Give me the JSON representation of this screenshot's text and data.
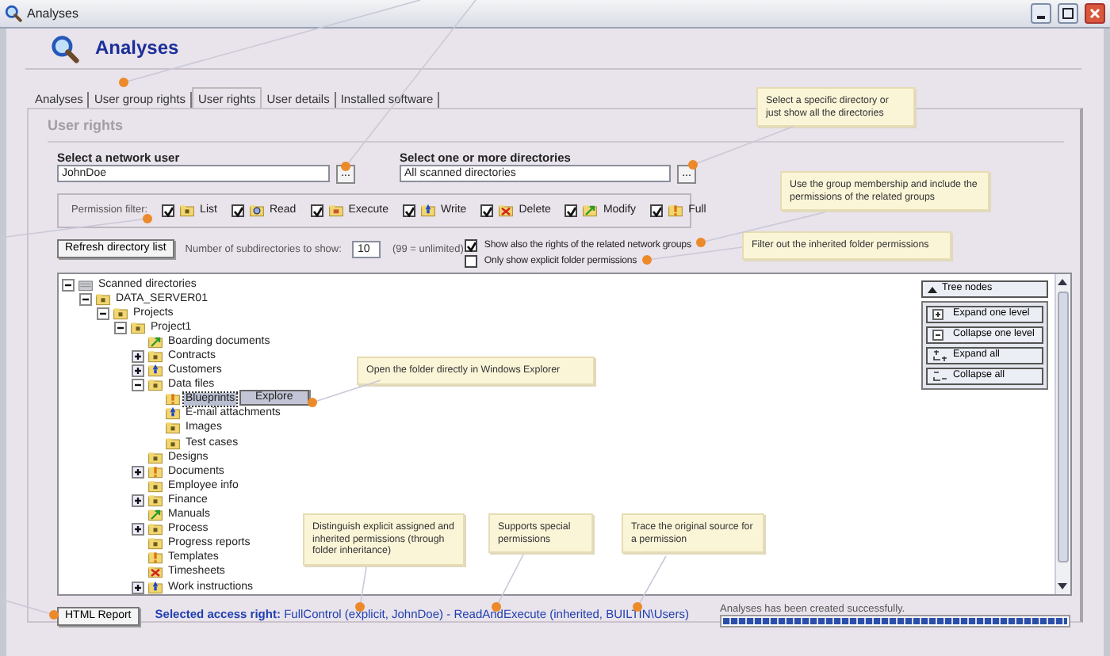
{
  "window": {
    "title": "Analyses"
  },
  "header": {
    "title": "Analyses"
  },
  "tabs": [
    {
      "label": "Analyses",
      "selected": false
    },
    {
      "label": "User group rights",
      "selected": false
    },
    {
      "label": "User rights",
      "selected": true
    },
    {
      "label": "User details",
      "selected": false
    },
    {
      "label": "Installed software",
      "selected": false
    }
  ],
  "section_title": "User rights",
  "user_select": {
    "label": "Select a network user",
    "value": "JohnDoe",
    "button": "..."
  },
  "directory_select": {
    "label": "Select one or more directories",
    "value": "All scanned directories",
    "button": "..."
  },
  "permission_filter": {
    "label": "Permission filter:",
    "items": [
      {
        "label": "List",
        "kind": "list",
        "checked": true
      },
      {
        "label": "Read",
        "kind": "read",
        "checked": true
      },
      {
        "label": "Execute",
        "kind": "execute",
        "checked": true
      },
      {
        "label": "Write",
        "kind": "write",
        "checked": true
      },
      {
        "label": "Delete",
        "kind": "delete",
        "checked": true
      },
      {
        "label": "Modify",
        "kind": "modify",
        "checked": true
      },
      {
        "label": "Full",
        "kind": "full",
        "checked": true
      }
    ]
  },
  "refresh_button": "Refresh directory list",
  "subdirectories": {
    "label": "Number of subdirectories to show:",
    "value": "10",
    "hint": "(99 = unlimited)"
  },
  "options": [
    {
      "label": "Show also the rights of the related network groups",
      "checked": true
    },
    {
      "label": "Only show explicit folder permissions",
      "checked": false
    }
  ],
  "tree": [
    {
      "label": "Scanned directories",
      "kind": "root",
      "expandable": true,
      "expanded": true,
      "selected": false,
      "children": [
        {
          "label": "DATA_SERVER01",
          "kind": "list",
          "expandable": true,
          "expanded": true,
          "selected": false,
          "children": [
            {
              "label": "Projects",
              "kind": "list",
              "expandable": true,
              "expanded": true,
              "selected": false,
              "children": [
                {
                  "label": "Project1",
                  "kind": "list",
                  "expandable": true,
                  "expanded": true,
                  "selected": false,
                  "children": [
                    {
                      "label": "Boarding documents",
                      "kind": "modify",
                      "expandable": false,
                      "selected": false
                    },
                    {
                      "label": "Contracts",
                      "kind": "list",
                      "expandable": true,
                      "expanded": false,
                      "selected": false
                    },
                    {
                      "label": "Customers",
                      "kind": "write",
                      "expandable": true,
                      "expanded": false,
                      "selected": false
                    },
                    {
                      "label": "Data files",
                      "kind": "list",
                      "expandable": true,
                      "expanded": true,
                      "selected": false,
                      "children": [
                        {
                          "label": "Blueprints",
                          "kind": "full",
                          "expandable": false,
                          "selected": true
                        },
                        {
                          "label": "E-mail attachments",
                          "kind": "write",
                          "expandable": false,
                          "selected": false
                        },
                        {
                          "label": "Images",
                          "kind": "list",
                          "expandable": false,
                          "selected": false
                        },
                        {
                          "label": "Test cases",
                          "kind": "list",
                          "expandable": false,
                          "selected": false
                        }
                      ]
                    },
                    {
                      "label": "Designs",
                      "kind": "list",
                      "expandable": false,
                      "selected": false
                    },
                    {
                      "label": "Documents",
                      "kind": "full",
                      "expandable": true,
                      "expanded": false,
                      "selected": false
                    },
                    {
                      "label": "Employee info",
                      "kind": "list",
                      "expandable": false,
                      "selected": false
                    },
                    {
                      "label": "Finance",
                      "kind": "list",
                      "expandable": true,
                      "expanded": false,
                      "selected": false
                    },
                    {
                      "label": "Manuals",
                      "kind": "modify",
                      "expandable": false,
                      "selected": false
                    },
                    {
                      "label": "Process",
                      "kind": "list",
                      "expandable": true,
                      "expanded": false,
                      "selected": false
                    },
                    {
                      "label": "Progress reports",
                      "kind": "list",
                      "expandable": false,
                      "selected": false
                    },
                    {
                      "label": "Templates",
                      "kind": "full",
                      "expandable": false,
                      "selected": false
                    },
                    {
                      "label": "Timesheets",
                      "kind": "delete",
                      "expandable": false,
                      "selected": false
                    },
                    {
                      "label": "Work instructions",
                      "kind": "write",
                      "expandable": true,
                      "expanded": false,
                      "selected": false
                    }
                  ]
                }
              ]
            }
          ]
        }
      ]
    }
  ],
  "context_menu": {
    "items": [
      "Explore"
    ]
  },
  "tree_nodes_panel": {
    "title": "Tree nodes",
    "buttons": [
      {
        "label": "Expand one level",
        "kind": "plus"
      },
      {
        "label": "Collapse one level",
        "kind": "minus"
      },
      {
        "label": "Expand all",
        "kind": "expand-all"
      },
      {
        "label": "Collapse all",
        "kind": "collapse-all"
      }
    ]
  },
  "html_report_button": "HTML Report",
  "selected_access_right": "**Selected access right:** FullControl (explicit, JohnDoe) - ReadAndExecute (inherited, BUILTIN\\Users)",
  "status": {
    "message": "Analyses has been created successfully.",
    "level": 1
  },
  "callouts": [
    {
      "text": "Select a specific directory or just show all the directories"
    },
    {
      "text": "Use the group membership and include the permissions of the related groups"
    },
    {
      "text": "Filter out the inherited folder permissions"
    },
    {
      "text": "Open the folder directly in Windows Explorer"
    },
    {
      "text": "Distinguish explicit assigned and inherited permissions (through folder inheritance)"
    },
    {
      "text": "Supports special permissions"
    },
    {
      "text": "Trace the original source for a permission"
    }
  ]
}
